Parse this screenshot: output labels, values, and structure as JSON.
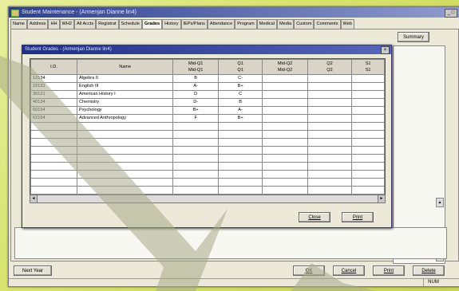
{
  "window": {
    "title": "Student Maintenance - (Armenjan Dianne lin4)",
    "caption_btn": "_ □"
  },
  "tabs": [
    {
      "label": "Name"
    },
    {
      "label": "Address"
    },
    {
      "label": "HH"
    },
    {
      "label": "WH2"
    },
    {
      "label": "All Accts"
    },
    {
      "label": "Registrat"
    },
    {
      "label": "Schedule"
    },
    {
      "label": "Grades"
    },
    {
      "label": "History"
    },
    {
      "label": "IEPs/Plans"
    },
    {
      "label": "Attendance"
    },
    {
      "label": "Program"
    },
    {
      "label": "Medical"
    },
    {
      "label": "Media"
    },
    {
      "label": "Custom"
    },
    {
      "label": "Comments"
    },
    {
      "label": "Web"
    }
  ],
  "summary_label": "Summary",
  "dialog": {
    "title": "Student Grades - (Armenjan Dianne lin4)",
    "close_glyph": "×",
    "columns": [
      {
        "label": "I.D."
      },
      {
        "label": "Name"
      },
      {
        "label": "Mid-Q1\nMid-Q1"
      },
      {
        "label": "Q1\nQ1"
      },
      {
        "label": "Mid-Q2\nMid-Q2"
      },
      {
        "label": "Q2\nQ2"
      },
      {
        "label": "S1\nS1"
      }
    ],
    "rows": [
      {
        "id": "12134",
        "name": "Algebra II",
        "mq1": "B",
        "q1": "C-"
      },
      {
        "id": "22131",
        "name": "English III",
        "mq1": "A-",
        "q1": "B+"
      },
      {
        "id": "30121",
        "name": "American History I",
        "mq1": "D",
        "q1": "C"
      },
      {
        "id": "40134",
        "name": "Chemistry",
        "mq1": "D-",
        "q1": "B"
      },
      {
        "id": "60154",
        "name": "Psychology",
        "mq1": "B+",
        "q1": "A-"
      },
      {
        "id": "62154",
        "name": "Advanced Anthropology",
        "mq1": "F",
        "q1": "B+"
      }
    ],
    "close_label": "Close",
    "print_label": "Print"
  },
  "bottom": {
    "next_year": "Next Year",
    "ok": "OK",
    "cancel": "Cancel",
    "print": "Print",
    "delete": "Delete"
  },
  "status": {
    "num": "NUM"
  },
  "colors": {
    "title_bar": "#2e3f8f",
    "background": "#d6e46c",
    "arrow": "#a6a777"
  }
}
